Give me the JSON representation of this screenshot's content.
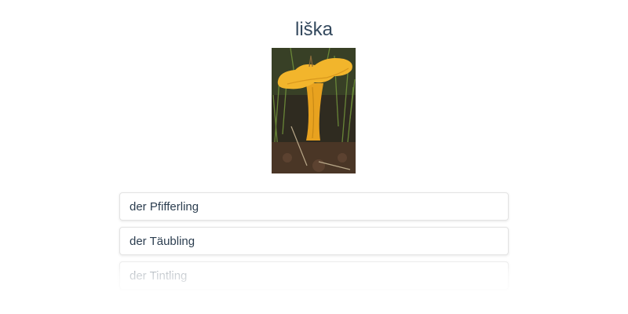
{
  "quiz": {
    "word": "liška",
    "image_subject": "chanterelle-mushroom-photo",
    "options": [
      {
        "label": "der Pfifferling"
      },
      {
        "label": "der Täubling"
      },
      {
        "label": "der Tintling"
      }
    ]
  },
  "colors": {
    "text": "#2c3e50",
    "title": "#34495e",
    "border": "#e3e3e3",
    "mushroom": "#f2b52c"
  }
}
